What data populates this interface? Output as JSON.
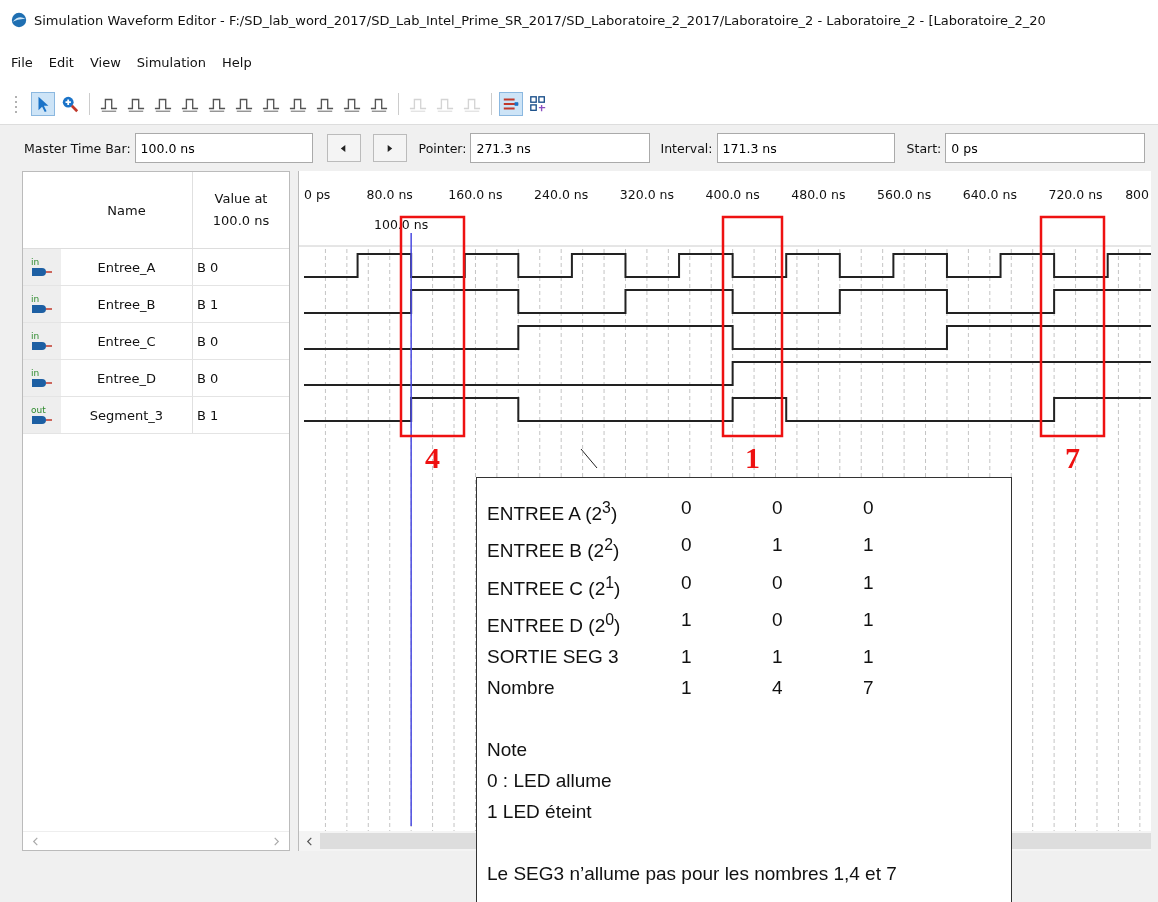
{
  "window": {
    "title": "Simulation Waveform Editor - F:/SD_lab_word_2017/SD_Lab_Intel_Prime_SR_2017/SD_Laboratoire_2_2017/Laboratoire_2 - Laboratoire_2 - [Laboratoire_2_20"
  },
  "menu": [
    "File",
    "Edit",
    "View",
    "Simulation",
    "Help"
  ],
  "toolbar": [
    {
      "kind": "pointer",
      "selected": true,
      "disabled": false
    },
    {
      "kind": "zoom",
      "selected": false,
      "disabled": false
    },
    {
      "kind": "separator"
    },
    {
      "kind": "wave",
      "selected": false,
      "disabled": false
    },
    {
      "kind": "wave",
      "selected": false,
      "disabled": false
    },
    {
      "kind": "wave",
      "selected": false,
      "disabled": false
    },
    {
      "kind": "wave",
      "selected": false,
      "disabled": false
    },
    {
      "kind": "wave",
      "selected": false,
      "disabled": false
    },
    {
      "kind": "wave",
      "selected": false,
      "disabled": false
    },
    {
      "kind": "wave",
      "selected": false,
      "disabled": false
    },
    {
      "kind": "wave",
      "selected": false,
      "disabled": false
    },
    {
      "kind": "wave",
      "selected": false,
      "disabled": false
    },
    {
      "kind": "wave",
      "selected": false,
      "disabled": false
    },
    {
      "kind": "wave",
      "selected": false,
      "disabled": false
    },
    {
      "kind": "separator"
    },
    {
      "kind": "wave",
      "selected": false,
      "disabled": true
    },
    {
      "kind": "wave",
      "selected": false,
      "disabled": true
    },
    {
      "kind": "wave",
      "selected": false,
      "disabled": true
    },
    {
      "kind": "separator"
    },
    {
      "kind": "bars",
      "selected": true,
      "disabled": false
    },
    {
      "kind": "grid",
      "selected": false,
      "disabled": false
    }
  ],
  "time_bar": {
    "master_label": "Master Time Bar:",
    "master_value": "100.0 ns",
    "pointer_label": "Pointer:",
    "pointer_value": "271.3 ns",
    "interval_label": "Interval:",
    "interval_value": "171.3 ns",
    "start_label": "Start:",
    "start_value": "0 ps"
  },
  "columns": {
    "name": "Name",
    "value": "Value at 100.0 ns"
  },
  "signals": [
    {
      "port_label": "in",
      "name": "Entree_A",
      "value": "B 0"
    },
    {
      "port_label": "in",
      "name": "Entree_B",
      "value": "B 1"
    },
    {
      "port_label": "in",
      "name": "Entree_C",
      "value": "B 0"
    },
    {
      "port_label": "in",
      "name": "Entree_D",
      "value": "B 0"
    },
    {
      "port_label": "out",
      "name": "Segment_3",
      "value": "B 1"
    }
  ],
  "timeline": {
    "ticks": [
      "0 ps",
      "80.0 ns",
      "160.0 ns",
      "240.0 ns",
      "320.0 ns",
      "400.0 ns",
      "480.0 ns",
      "560.0 ns",
      "640.0 ns",
      "720.0 ns",
      "800"
    ],
    "cursor_label": "100.0 ns"
  },
  "highlights": [
    {
      "label": "4"
    },
    {
      "label": "1"
    },
    {
      "label": "7"
    }
  ],
  "note_box": {
    "rows": [
      {
        "label": "ENTREE A (2$^{3}$)",
        "values": [
          "0",
          "0",
          "0"
        ]
      },
      {
        "label": "ENTREE B (2$^{2}$)",
        "values": [
          "0",
          "1",
          "1"
        ]
      },
      {
        "label": "ENTREE C (2$^{1}$)",
        "values": [
          "0",
          "0",
          "1"
        ]
      },
      {
        "label": "ENTREE D (2$^{0}$)",
        "values": [
          "1",
          "0",
          "1"
        ]
      },
      {
        "label": "SORTIE SEG 3",
        "values": [
          "1",
          "1",
          "1"
        ]
      },
      {
        "label": "Nombre",
        "values": [
          "1",
          "4",
          "7"
        ]
      }
    ],
    "note_title": "Note",
    "note_lines": [
      "0 : LED allume",
      "1 LED éteint"
    ],
    "conclusion": "Le SEG3 n’allume pas pour les nombres 1,4 et 7"
  }
}
